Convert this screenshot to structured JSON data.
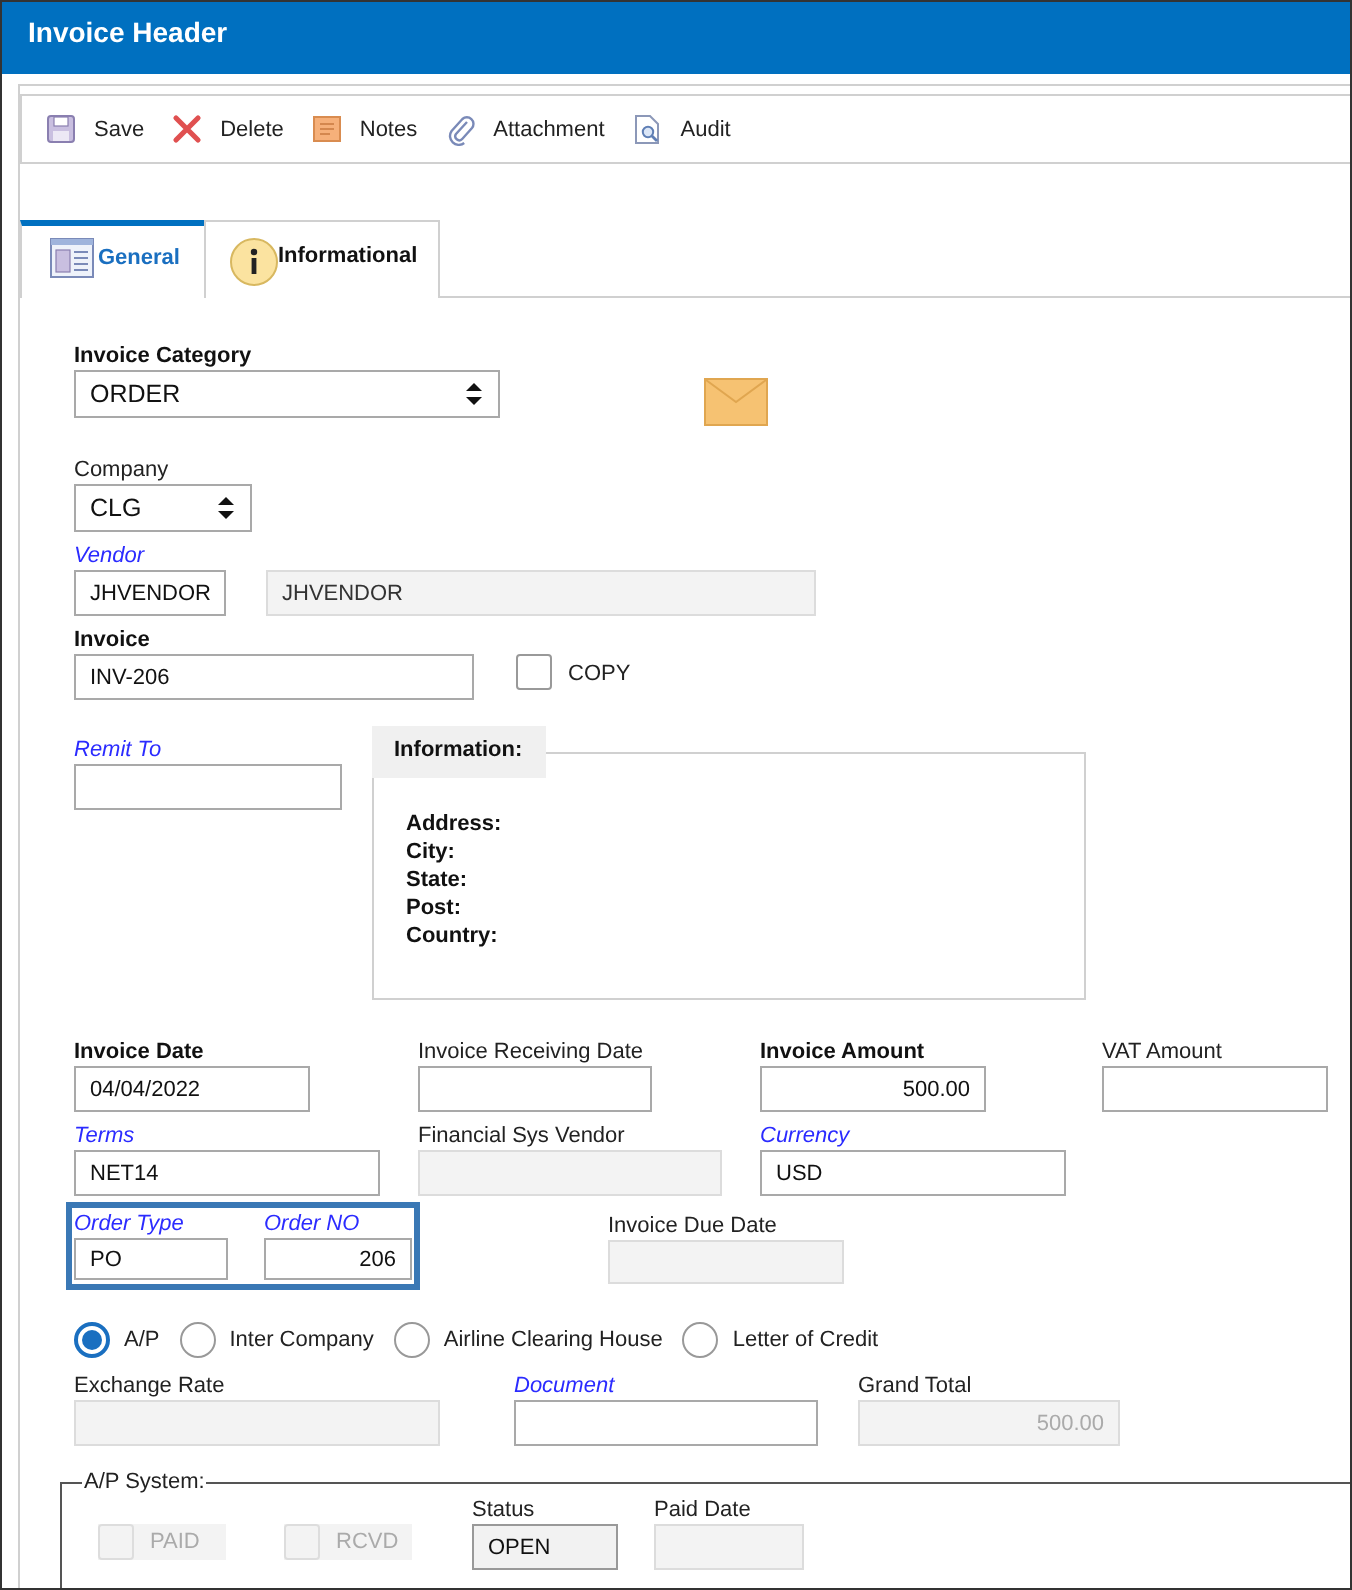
{
  "window": {
    "title": "Invoice Header"
  },
  "toolbar": [
    {
      "label": "Save",
      "kind": "save"
    },
    {
      "label": "Delete",
      "kind": "delete"
    },
    {
      "label": "Notes",
      "kind": "notes"
    },
    {
      "label": "Attachment",
      "kind": "attachment"
    },
    {
      "label": "Audit",
      "kind": "audit"
    }
  ],
  "tabs": [
    {
      "label": "General",
      "kind": "form",
      "selected": true
    },
    {
      "label": "Informational",
      "kind": "info",
      "selected": false
    }
  ],
  "invoice_category": {
    "label": "Invoice Category",
    "kind": "bold",
    "value": "ORDER"
  },
  "company": {
    "label": "Company",
    "kind": "plain",
    "value": "CLG"
  },
  "vendor": {
    "label": "Vendor",
    "kind": "link",
    "code": "JHVENDOR",
    "name": "JHVENDOR"
  },
  "invoice": {
    "label": "Invoice",
    "kind": "bold",
    "value": "INV-206"
  },
  "copy": {
    "label": "COPY",
    "checked": false
  },
  "remit_to": {
    "label": "Remit To",
    "kind": "link"
  },
  "information": {
    "title": "Information:",
    "lines": [
      "Address:",
      "City:",
      "State:",
      "Post:",
      "Country:"
    ]
  },
  "date_row": [
    {
      "label": "Invoice Date",
      "kind": "bold",
      "value": "04/04/2022",
      "disabled": false
    },
    {
      "label": "Invoice Receiving Date",
      "kind": "plain",
      "disabled": false
    },
    {
      "label": "Invoice Amount",
      "kind": "bold",
      "value": "500.00",
      "disabled": false
    },
    {
      "label": "VAT Amount",
      "kind": "plain",
      "disabled": false
    }
  ],
  "terms_row": [
    {
      "label": "Terms",
      "kind": "link",
      "value": "NET14",
      "disabled": false
    },
    {
      "label": "Financial Sys Vendor",
      "kind": "plain",
      "disabled": true
    },
    {
      "label": "Currency",
      "kind": "link",
      "value": "USD",
      "disabled": false
    }
  ],
  "order": {
    "highlighted": true,
    "fields": [
      {
        "label": "Order Type",
        "kind": "link",
        "value": "PO",
        "disabled": false
      },
      {
        "label": "Order NO",
        "kind": "link",
        "value": "206",
        "disabled": false
      }
    ]
  },
  "due_date": {
    "label": "Invoice Due Date",
    "kind": "plain",
    "disabled": true
  },
  "payment_type": [
    {
      "label": "A/P",
      "selected": true
    },
    {
      "label": "Inter Company",
      "selected": false
    },
    {
      "label": "Airline Clearing House",
      "selected": false
    },
    {
      "label": "Letter of Credit",
      "selected": false
    }
  ],
  "exchange_row": [
    {
      "label": "Exchange Rate",
      "kind": "plain",
      "disabled": true
    },
    {
      "label": "Document",
      "kind": "link",
      "disabled": false
    },
    {
      "label": "Grand Total",
      "kind": "plain",
      "value": "500.00",
      "disabled": true
    }
  ],
  "ap_system": {
    "title": "A/P System:",
    "flags": [
      {
        "label": "PAID",
        "checked": false,
        "disabled": true
      },
      {
        "label": "RCVD",
        "checked": false,
        "disabled": true
      }
    ],
    "status": {
      "label": "Status",
      "kind": "plain",
      "value": "OPEN",
      "disabled": true
    },
    "paid_date": {
      "label": "Paid Date",
      "kind": "plain",
      "disabled": true
    }
  }
}
